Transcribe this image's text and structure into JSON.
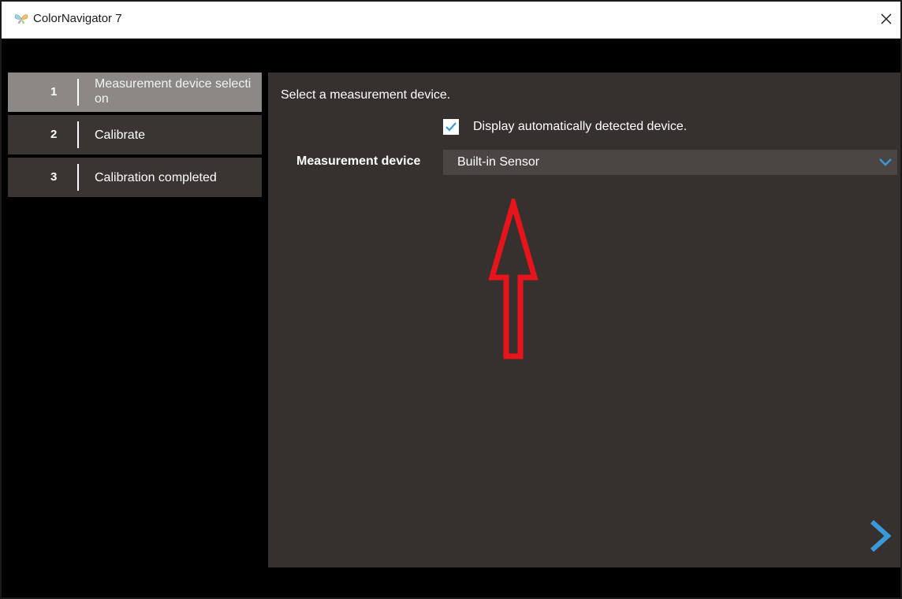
{
  "window": {
    "title": "ColorNavigator 7",
    "app_icon": "butterfly-logo-icon",
    "close_icon": "close-icon"
  },
  "steps": [
    {
      "number": "1",
      "label": "Measurement device selection",
      "active": true
    },
    {
      "number": "2",
      "label": "Calibrate",
      "active": false
    },
    {
      "number": "3",
      "label": "Calibration completed",
      "active": false
    }
  ],
  "main": {
    "instruction": "Select a measurement device.",
    "auto_detect": {
      "label": "Display automatically detected device.",
      "checked": true
    },
    "device": {
      "label": "Measurement device",
      "selected": "Built-in Sensor",
      "dropdown_icon": "chevron-down-icon"
    },
    "next_icon": "chevron-right-icon"
  },
  "colors": {
    "accent": "#3a9ad9",
    "annotation": "#e8141c",
    "panel": "#36312e",
    "step_active": "#8c8886",
    "step_inactive": "#3a3532"
  }
}
